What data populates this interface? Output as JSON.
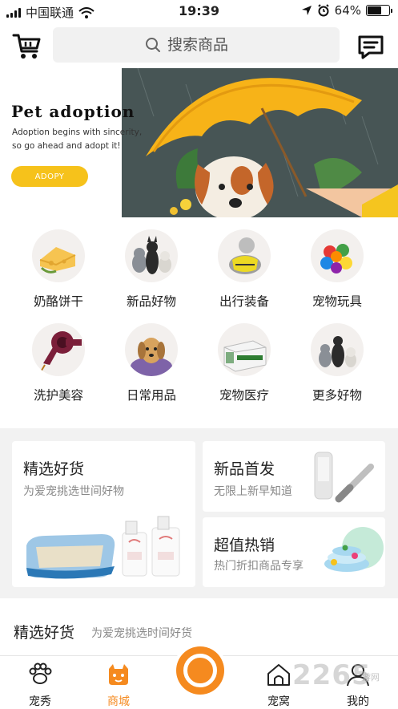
{
  "status_bar": {
    "carrier": "中国联通",
    "time": "19:39",
    "battery": "64%",
    "battery_level": 0.64
  },
  "header": {
    "search_placeholder": "搜索商品",
    "cart_icon": "cart-icon",
    "message_icon": "message-icon"
  },
  "banner": {
    "title": "Pet  adoption",
    "subtitle": "Adoption begins with sincerity, so go ahead and adopt it!",
    "button": "ADOPY"
  },
  "categories": [
    {
      "label": "奶酪饼干",
      "icon": "cheese-icon"
    },
    {
      "label": "新品好物",
      "icon": "dog-cat-icon"
    },
    {
      "label": "出行装备",
      "icon": "dog-vest-icon"
    },
    {
      "label": "宠物玩具",
      "icon": "toy-ball-icon"
    },
    {
      "label": "洗护美容",
      "icon": "hair-dryer-icon"
    },
    {
      "label": "日常用品",
      "icon": "puppy-towel-icon"
    },
    {
      "label": "宠物医疗",
      "icon": "test-kit-icon"
    },
    {
      "label": "更多好物",
      "icon": "pets-group-icon"
    }
  ],
  "cards": {
    "select": {
      "title": "精选好货",
      "subtitle": "为爱宠挑选世间好物"
    },
    "new": {
      "title": "新品首发",
      "subtitle": "无限上新早知道"
    },
    "hot": {
      "title": "超值热销",
      "subtitle": "热门折扣商品专享"
    }
  },
  "featured": {
    "title": "精选好货",
    "subtitle": "为爱宠挑选时间好货"
  },
  "tabs": [
    {
      "label": "宠秀",
      "icon": "paw-icon"
    },
    {
      "label": "商城",
      "icon": "shop-dog-icon"
    },
    {
      "label": "宠窝",
      "icon": "pet-house-icon"
    },
    {
      "label": "我的",
      "icon": "user-icon"
    }
  ],
  "watermark": {
    "text": "2265",
    "sub": "游网"
  },
  "colors": {
    "accent": "#f58a1f",
    "banner_button": "#f6c21b"
  }
}
